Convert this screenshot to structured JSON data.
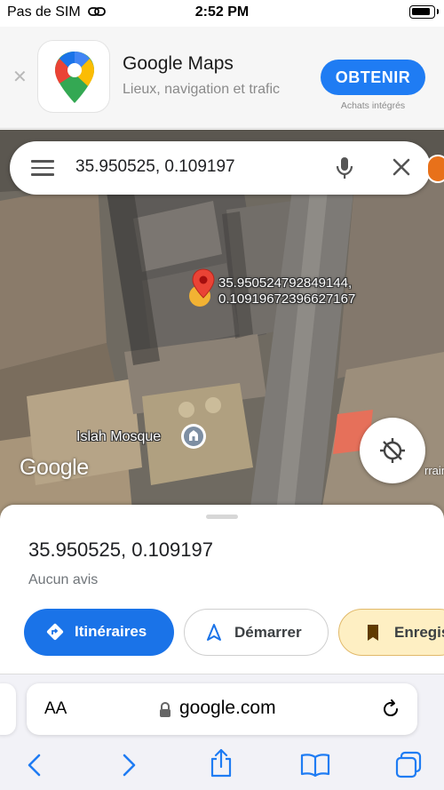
{
  "status_bar": {
    "carrier": "Pas de SIM",
    "time": "2:52 PM"
  },
  "app_banner": {
    "app_name": "Google Maps",
    "subtitle": "Lieux, navigation et trafic",
    "get_label": "OBTENIR",
    "in_app_purchases": "Achats intégrés"
  },
  "map": {
    "search_query": "35.950525, 0.109197",
    "pin_label_lat": "35.950524792849144,",
    "pin_label_lng": "0.10919672396627167",
    "poi_label": "Islah Mosque",
    "attribution": "Google",
    "edge_label": "rrain"
  },
  "place": {
    "title": "35.950525, 0.109197",
    "reviews": "Aucun avis"
  },
  "actions": {
    "directions": "Itinéraires",
    "start": "Démarrer",
    "save": "Enregis"
  },
  "browser": {
    "text_size_label": "AA",
    "url": "google.com"
  },
  "colors": {
    "accent_blue": "#1a73e8",
    "banner_button": "#1f7cf3",
    "save_button_bg": "#feefc3",
    "pin_red": "#ea4335"
  }
}
